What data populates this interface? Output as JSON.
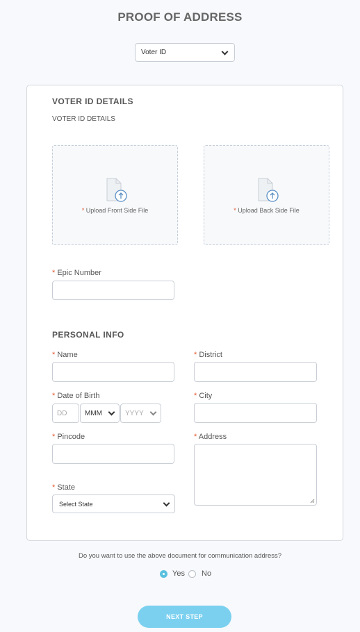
{
  "page": {
    "title": "PROOF OF ADDRESS"
  },
  "document_type": {
    "selected": "Voter ID"
  },
  "voter_section": {
    "title": "VOTER ID DETAILS",
    "subtitle": "VOTER ID DETAILS",
    "front_upload_label": "Upload Front Side File",
    "back_upload_label": "Upload Back Side File",
    "epic_label": "Epic Number",
    "required_mark": "*"
  },
  "personal_section": {
    "title": "PERSONAL INFO",
    "name_label": "Name",
    "district_label": "District",
    "dob_label": "Date of Birth",
    "dob_day_placeholder": "DD",
    "dob_month_value": "MMM",
    "dob_year_value": "YYYY",
    "city_label": "City",
    "pincode_label": "Pincode",
    "address_label": "Address",
    "state_label": "State",
    "state_value": "Select State"
  },
  "communication": {
    "question": "Do you want to use the above document for communication address?",
    "yes_label": "Yes",
    "no_label": "No",
    "selected": "Yes"
  },
  "actions": {
    "next_label": "NEXT STEP"
  },
  "colors": {
    "accent": "#7bd0ef",
    "required": "#e4572e",
    "radio_checked": "#5bc0de"
  }
}
